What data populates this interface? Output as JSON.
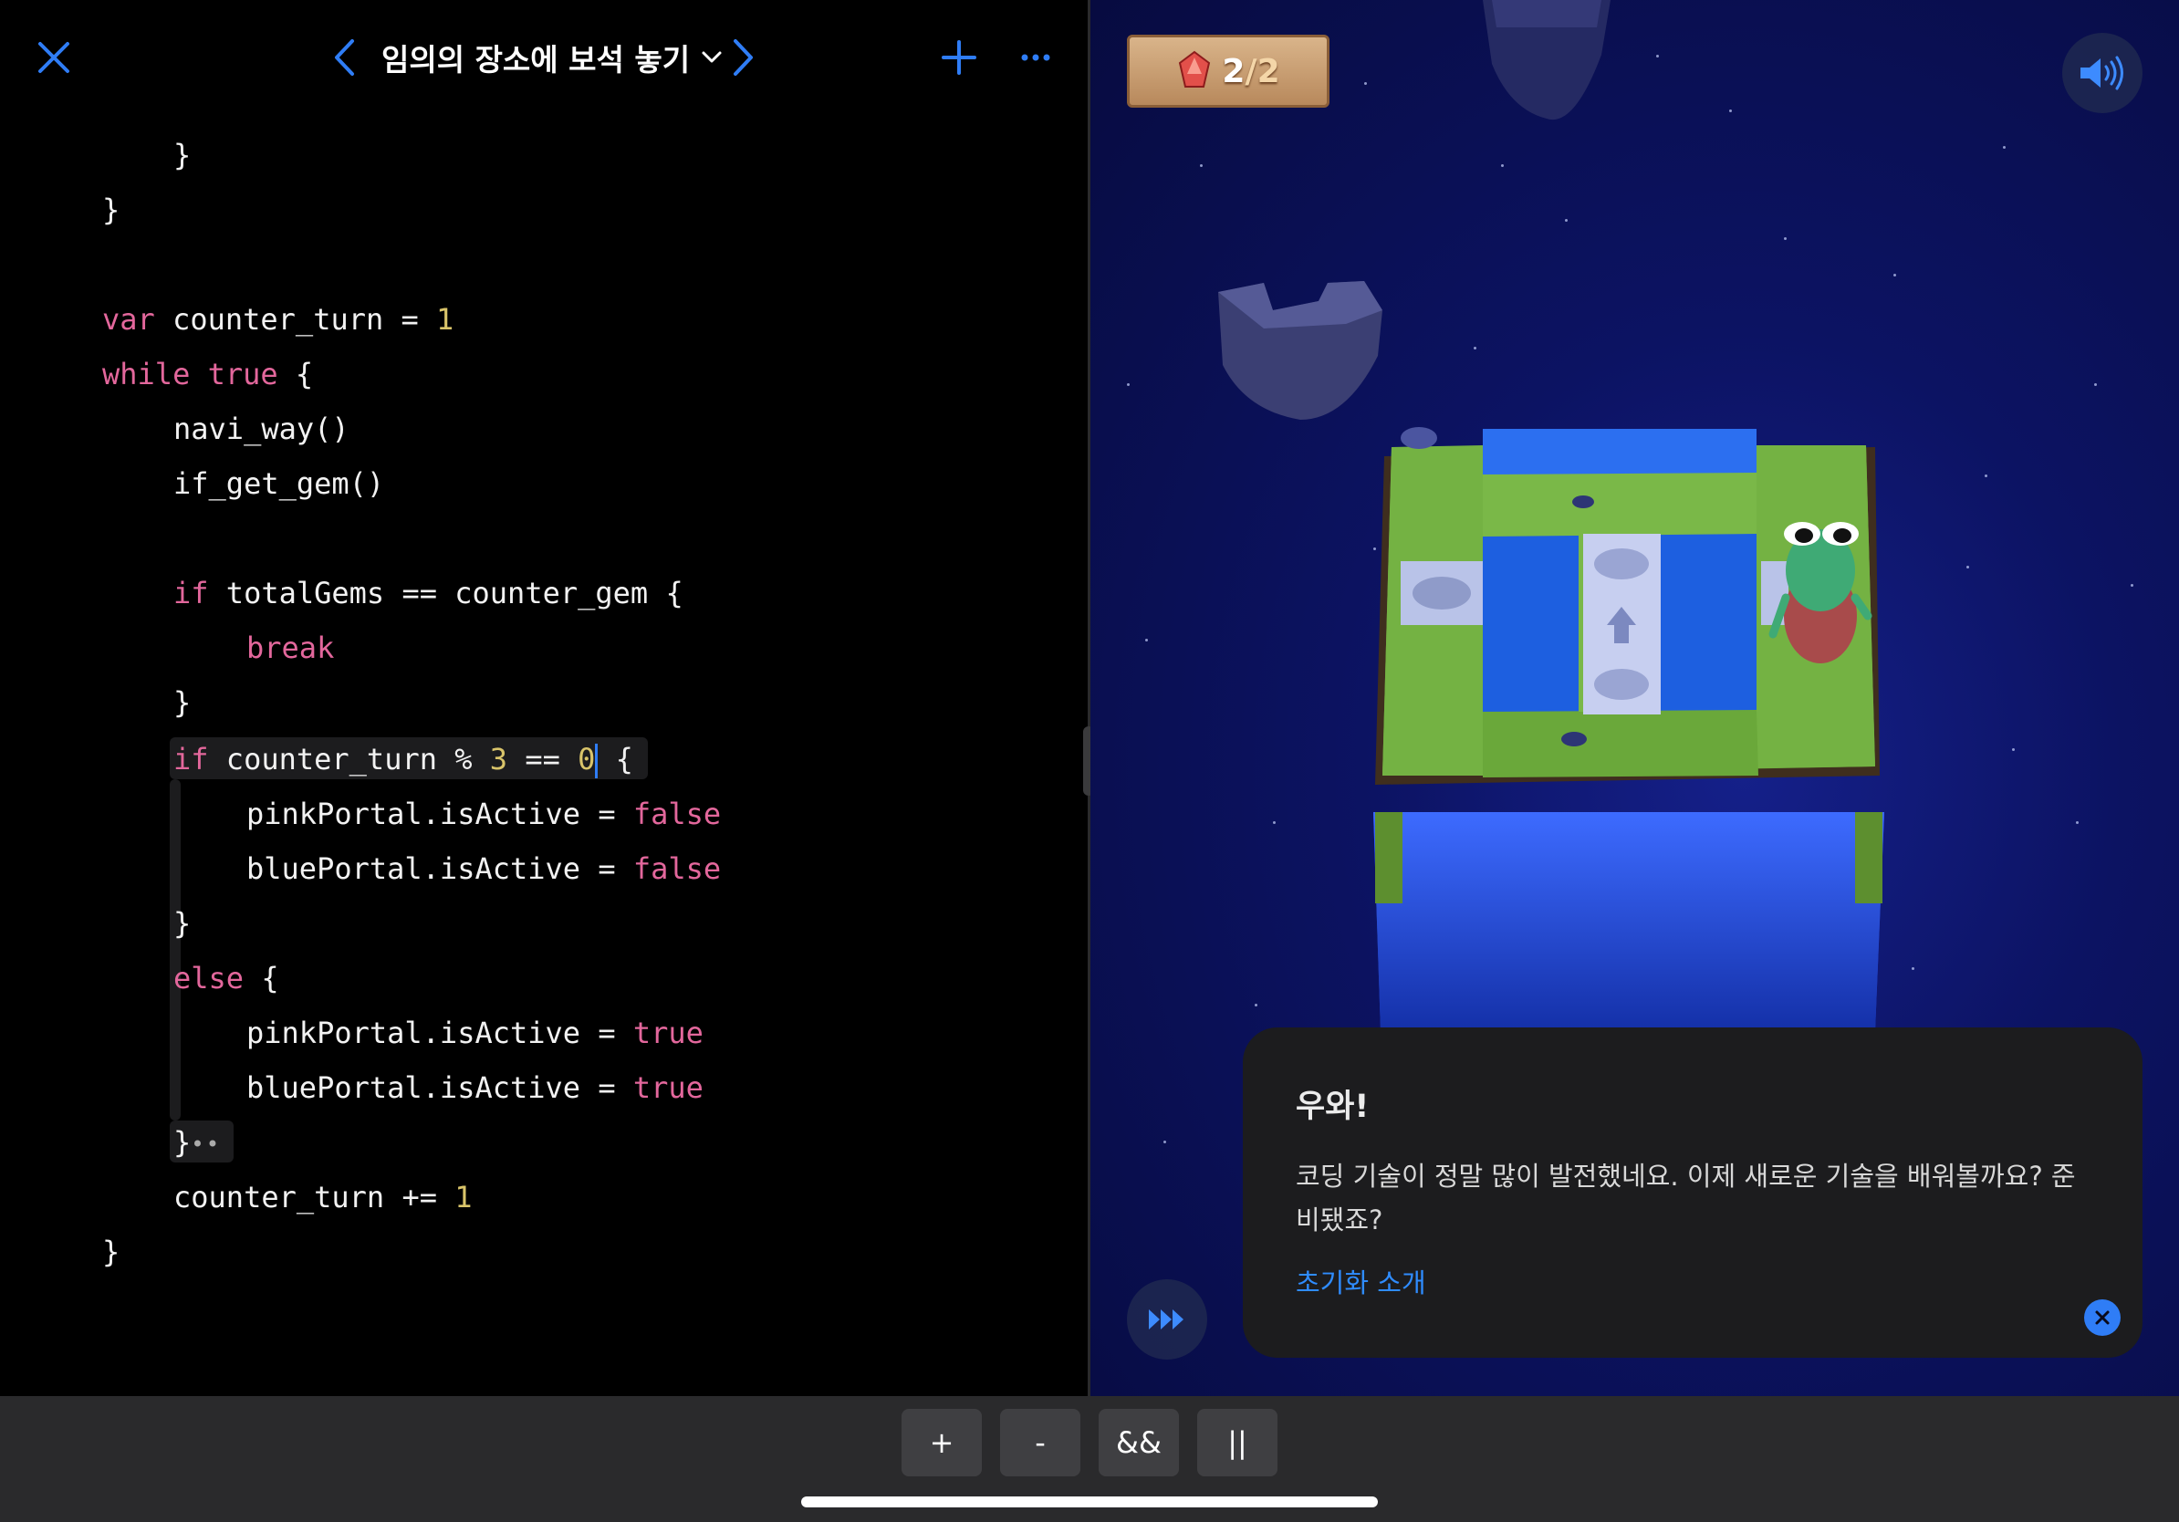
{
  "topbar": {
    "title": "임의의 장소에 보석 놓기",
    "close_icon": "close-icon",
    "prev_icon": "chevron-left-icon",
    "next_icon": "chevron-right-icon",
    "add_icon": "plus-icon",
    "more_icon": "more-icon",
    "accent": "#2f7df6"
  },
  "code": {
    "lines": [
      {
        "id": "l1",
        "parts": [
          {
            "t": "}",
            "c": ""
          }
        ]
      },
      {
        "id": "l2",
        "parts": [
          {
            "t": "}",
            "c": ""
          }
        ]
      },
      {
        "id": "l3",
        "parts": [
          {
            "t": "var",
            "c": "kw"
          },
          {
            "t": " counter_turn = ",
            "c": ""
          },
          {
            "t": "1",
            "c": "num"
          }
        ]
      },
      {
        "id": "l4",
        "parts": [
          {
            "t": "while",
            "c": "kw"
          },
          {
            "t": " ",
            "c": ""
          },
          {
            "t": "true",
            "c": "kw"
          },
          {
            "t": " {",
            "c": ""
          }
        ]
      },
      {
        "id": "l5",
        "parts": [
          {
            "t": "navi_way()",
            "c": ""
          }
        ]
      },
      {
        "id": "l6",
        "parts": [
          {
            "t": "if_get_gem()",
            "c": ""
          }
        ]
      },
      {
        "id": "l7",
        "parts": [
          {
            "t": "if",
            "c": "kw"
          },
          {
            "t": " totalGems == counter_gem {",
            "c": ""
          }
        ]
      },
      {
        "id": "l8",
        "parts": [
          {
            "t": "break",
            "c": "kw"
          }
        ]
      },
      {
        "id": "l9",
        "parts": [
          {
            "t": "}",
            "c": ""
          }
        ]
      },
      {
        "id": "l10",
        "parts": [
          {
            "t": "if",
            "c": "kw"
          },
          {
            "t": " counter_turn % ",
            "c": ""
          },
          {
            "t": "3",
            "c": "num"
          },
          {
            "t": " == ",
            "c": ""
          },
          {
            "t": "0",
            "c": "num"
          },
          {
            "t": "|",
            "c": "cursor"
          },
          {
            "t": " {",
            "c": ""
          }
        ]
      },
      {
        "id": "l11",
        "parts": [
          {
            "t": "pinkPortal.isActive = ",
            "c": ""
          },
          {
            "t": "false",
            "c": "kw"
          }
        ]
      },
      {
        "id": "l12",
        "parts": [
          {
            "t": "bluePortal.isActive = ",
            "c": ""
          },
          {
            "t": "false",
            "c": "kw"
          }
        ]
      },
      {
        "id": "l13",
        "parts": [
          {
            "t": "}",
            "c": ""
          }
        ]
      },
      {
        "id": "l14",
        "parts": [
          {
            "t": "else",
            "c": "kw"
          },
          {
            "t": " {",
            "c": ""
          }
        ]
      },
      {
        "id": "l15",
        "parts": [
          {
            "t": "pinkPortal.isActive = ",
            "c": ""
          },
          {
            "t": "true",
            "c": "kw"
          }
        ]
      },
      {
        "id": "l16",
        "parts": [
          {
            "t": "bluePortal.isActive = ",
            "c": ""
          },
          {
            "t": "true",
            "c": "kw"
          }
        ]
      },
      {
        "id": "l17",
        "parts": [
          {
            "t": "}",
            "c": ""
          },
          {
            "t": "••",
            "c": "fold"
          }
        ]
      },
      {
        "id": "l18",
        "parts": [
          {
            "t": "counter_turn += ",
            "c": ""
          },
          {
            "t": "1",
            "c": "num"
          }
        ]
      },
      {
        "id": "l19",
        "parts": [
          {
            "t": "}",
            "c": ""
          }
        ]
      }
    ],
    "keyword_color": "#e3679c",
    "number_color": "#d9c46a"
  },
  "scene": {
    "gem_count": "2",
    "gem_total": "/2",
    "gem_icon": "gem-icon",
    "sound_icon": "speaker-icon",
    "fast_forward_icon": "fast-forward-icon"
  },
  "dialog": {
    "title": "우와!",
    "body": "코딩 기술이 정말 많이 발전했네요. 이제 새로운 기술을 배워볼까요? 준비됐죠?",
    "link": "초기화 소개",
    "close_icon": "close-circle-icon"
  },
  "keys": [
    {
      "label": "+"
    },
    {
      "label": "-"
    },
    {
      "label": "&&"
    },
    {
      "label": "||"
    }
  ]
}
